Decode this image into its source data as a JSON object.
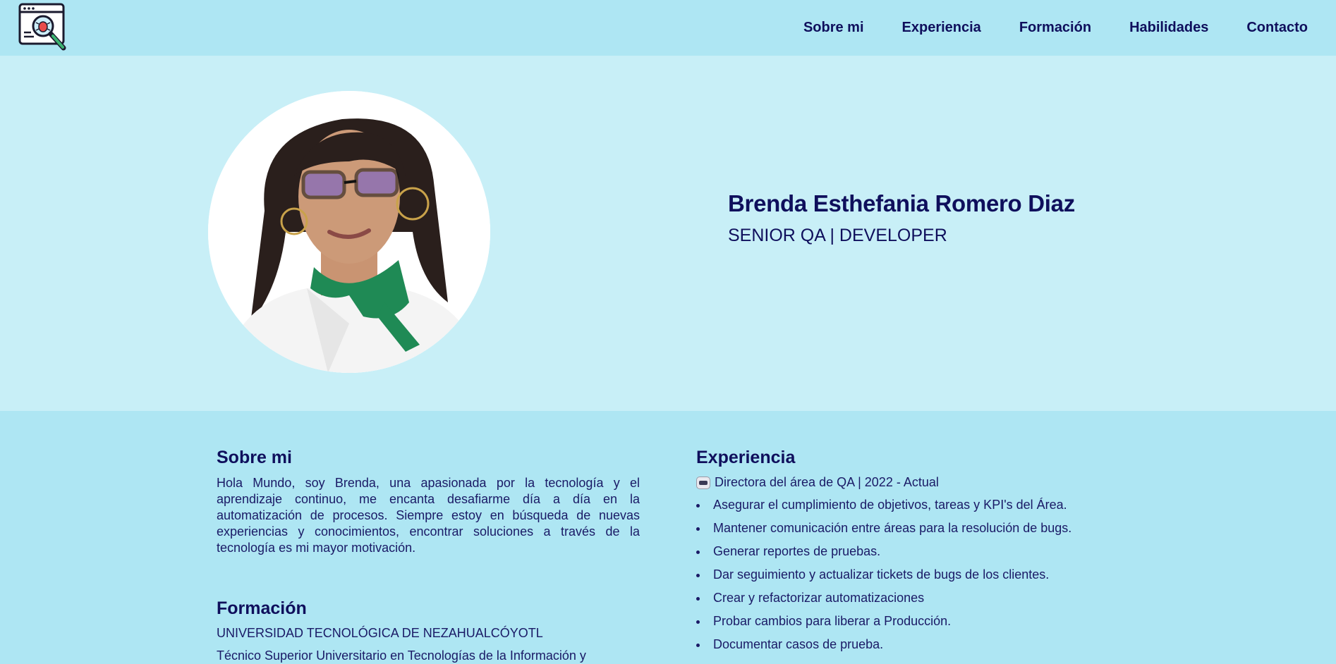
{
  "header": {
    "logo_icon": "bug-search-window-icon",
    "nav": [
      {
        "label": "Sobre mi"
      },
      {
        "label": "Experiencia"
      },
      {
        "label": "Formación"
      },
      {
        "label": "Habilidades"
      },
      {
        "label": "Contacto"
      }
    ]
  },
  "hero": {
    "name": "Brenda Esthefania Romero Diaz",
    "role": "SENIOR QA | DEVELOPER"
  },
  "about": {
    "title": "Sobre mi",
    "text": "Hola Mundo, soy Brenda, una apasionada por la tecnología y el aprendizaje continuo, me encanta desafiarme día a día en la automatización de procesos. Siempre estoy en búsqueda de nuevas experiencias y conocimientos, encontrar soluciones a través de la tecnología es mi mayor motivación."
  },
  "education": {
    "title": "Formación",
    "school": "UNIVERSIDAD TECNOLÓGICA DE NEZAHUALCÓYOTL",
    "degree": "Técnico Superior Universitario en Tecnologías de la Información y"
  },
  "experience": {
    "title": "Experiencia",
    "job": "Directora del área de QA | 2022 - Actual",
    "duties": [
      "Asegurar el cumplimiento de objetivos, tareas y KPI's del Área.",
      "Mantener comunicación entre áreas para la resolución de bugs.",
      "Generar reportes de pruebas.",
      "Dar seguimiento y actualizar tickets de bugs de los clientes.",
      "Crear y refactorizar automatizaciones",
      "Probar cambios para liberar a Producción.",
      "Documentar casos de prueba."
    ]
  },
  "colors": {
    "header_bg": "#aee6f3",
    "hero_bg": "#c8eff7",
    "text": "#0f0f5c"
  }
}
